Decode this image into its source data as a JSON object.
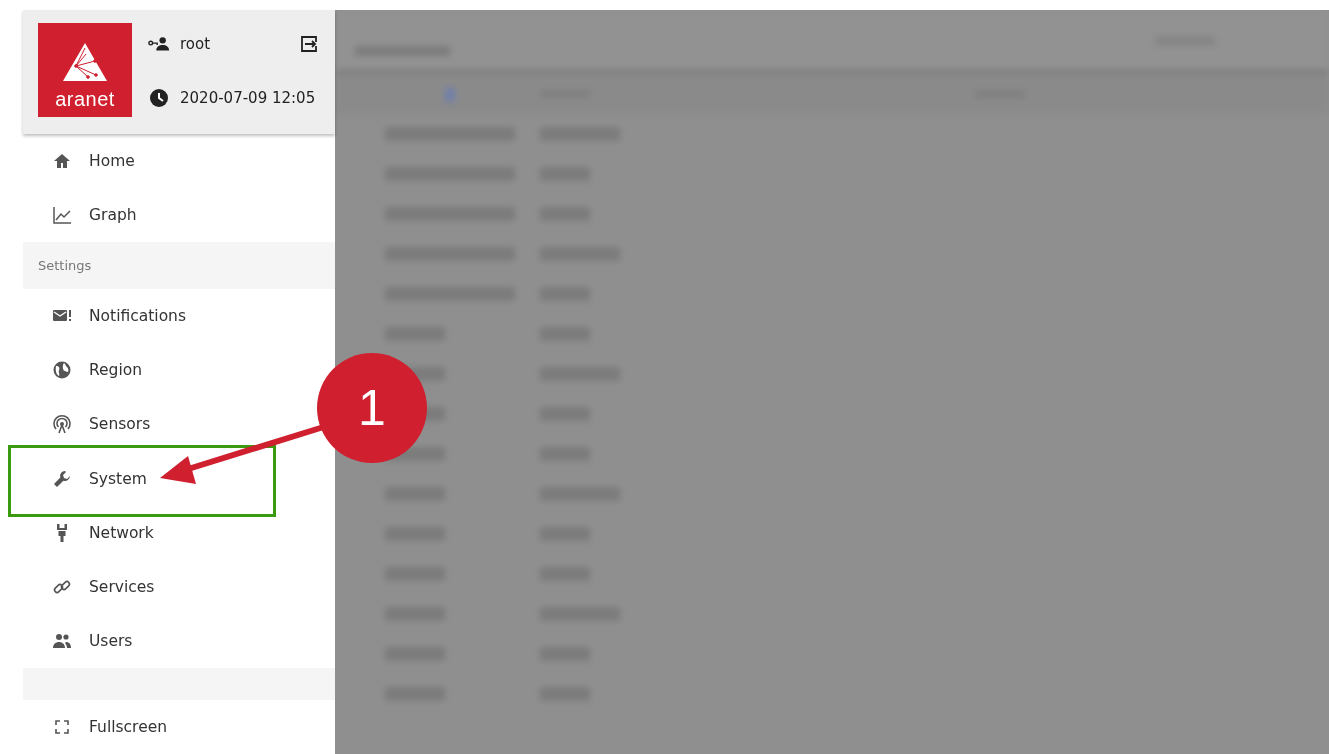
{
  "header": {
    "logo_text": "aranet",
    "user": "root",
    "datetime": "2020-07-09 12:05"
  },
  "nav": [
    {
      "kind": "item",
      "label": "Home",
      "highlighted": false
    },
    {
      "kind": "item",
      "label": "Graph",
      "highlighted": false
    },
    {
      "kind": "section",
      "label": "Settings"
    },
    {
      "kind": "item",
      "label": "Notifications",
      "highlighted": false
    },
    {
      "kind": "item",
      "label": "Region",
      "highlighted": false
    },
    {
      "kind": "item",
      "label": "Sensors",
      "highlighted": false
    },
    {
      "kind": "item",
      "label": "System",
      "highlighted": true
    },
    {
      "kind": "item",
      "label": "Network",
      "highlighted": false
    },
    {
      "kind": "item",
      "label": "Services",
      "highlighted": false
    },
    {
      "kind": "item",
      "label": "Users",
      "highlighted": false
    },
    {
      "kind": "spacer"
    },
    {
      "kind": "item",
      "label": "Fullscreen",
      "highlighted": false
    }
  ],
  "callout": {
    "number": "1"
  }
}
